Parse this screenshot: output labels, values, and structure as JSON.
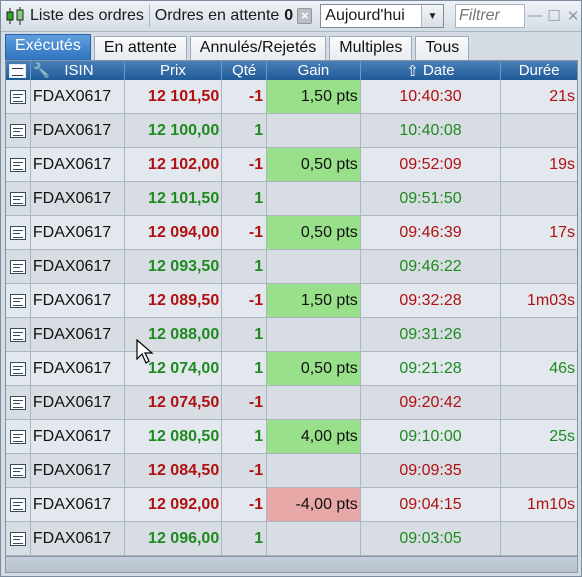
{
  "titlebar": {
    "title": "Liste des ordres",
    "pending_label": "Ordres en attente",
    "pending_count": "0",
    "period_select": "Aujourd'hui",
    "filter_placeholder": "Filtrer",
    "clear_icon": "×",
    "minimize_icon": "—",
    "maximize_icon": "☐",
    "close_icon": "✕"
  },
  "tabs": [
    {
      "label": "Exécutés",
      "active": true
    },
    {
      "label": "En attente",
      "active": false
    },
    {
      "label": "Annulés/Rejetés",
      "active": false
    },
    {
      "label": "Multiples",
      "active": false
    },
    {
      "label": "Tous",
      "active": false
    }
  ],
  "columns": {
    "isin": "ISIN",
    "prix": "Prix",
    "qte": "Qté",
    "gain": "Gain",
    "date": "Date",
    "date_sort_icon": "⇧",
    "duree": "Durée"
  },
  "colors": {
    "sell": "#b01010",
    "buy": "#1f8a1f",
    "gain_positive": "#98e08a",
    "gain_negative": "#e8a8a8",
    "active_tab": "#2f73c0"
  },
  "rows": [
    {
      "isin": "FDAX0617",
      "prix": "12 101,50",
      "qte": "-1",
      "gain": "1,50 pts",
      "date": "10:40:30",
      "duree": "21s",
      "side": "sell",
      "gain_sign": "pos"
    },
    {
      "isin": "FDAX0617",
      "prix": "12 100,00",
      "qte": "1",
      "gain": "",
      "date": "10:40:08",
      "duree": "",
      "side": "buy",
      "gain_sign": ""
    },
    {
      "isin": "FDAX0617",
      "prix": "12 102,00",
      "qte": "-1",
      "gain": "0,50 pts",
      "date": "09:52:09",
      "duree": "19s",
      "side": "sell",
      "gain_sign": "pos"
    },
    {
      "isin": "FDAX0617",
      "prix": "12 101,50",
      "qte": "1",
      "gain": "",
      "date": "09:51:50",
      "duree": "",
      "side": "buy",
      "gain_sign": ""
    },
    {
      "isin": "FDAX0617",
      "prix": "12 094,00",
      "qte": "-1",
      "gain": "0,50 pts",
      "date": "09:46:39",
      "duree": "17s",
      "side": "sell",
      "gain_sign": "pos"
    },
    {
      "isin": "FDAX0617",
      "prix": "12 093,50",
      "qte": "1",
      "gain": "",
      "date": "09:46:22",
      "duree": "",
      "side": "buy",
      "gain_sign": ""
    },
    {
      "isin": "FDAX0617",
      "prix": "12 089,50",
      "qte": "-1",
      "gain": "1,50 pts",
      "date": "09:32:28",
      "duree": "1m03s",
      "side": "sell",
      "gain_sign": "pos"
    },
    {
      "isin": "FDAX0617",
      "prix": "12 088,00",
      "qte": "1",
      "gain": "",
      "date": "09:31:26",
      "duree": "",
      "side": "buy",
      "gain_sign": ""
    },
    {
      "isin": "FDAX0617",
      "prix": "12 074,00",
      "qte": "1",
      "gain": "0,50 pts",
      "date": "09:21:28",
      "duree": "46s",
      "side": "buy",
      "gain_sign": "pos"
    },
    {
      "isin": "FDAX0617",
      "prix": "12 074,50",
      "qte": "-1",
      "gain": "",
      "date": "09:20:42",
      "duree": "",
      "side": "sell",
      "gain_sign": ""
    },
    {
      "isin": "FDAX0617",
      "prix": "12 080,50",
      "qte": "1",
      "gain": "4,00 pts",
      "date": "09:10:00",
      "duree": "25s",
      "side": "buy",
      "gain_sign": "pos"
    },
    {
      "isin": "FDAX0617",
      "prix": "12 084,50",
      "qte": "-1",
      "gain": "",
      "date": "09:09:35",
      "duree": "",
      "side": "sell",
      "gain_sign": ""
    },
    {
      "isin": "FDAX0617",
      "prix": "12 092,00",
      "qte": "-1",
      "gain": "-4,00 pts",
      "date": "09:04:15",
      "duree": "1m10s",
      "side": "sell",
      "gain_sign": "neg"
    },
    {
      "isin": "FDAX0617",
      "prix": "12 096,00",
      "qte": "1",
      "gain": "",
      "date": "09:03:05",
      "duree": "",
      "side": "buy",
      "gain_sign": ""
    }
  ]
}
